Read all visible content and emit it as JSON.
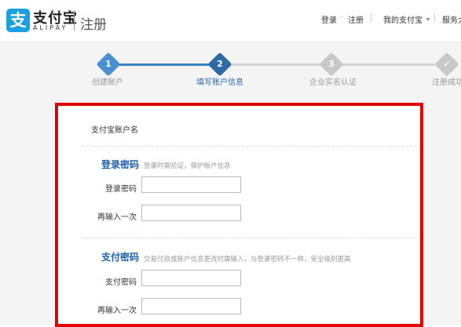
{
  "header": {
    "logo_cn": "支付宝",
    "logo_en": "ALIPAY",
    "page_title": "注册",
    "nav": {
      "login": "登录",
      "dot": "·",
      "register": "注册",
      "my_alipay": "我的支付宝",
      "service": "服务大"
    }
  },
  "steps": [
    {
      "num": "1",
      "label": "创建账户",
      "state": "done"
    },
    {
      "num": "2",
      "label": "填写账户信息",
      "state": "active"
    },
    {
      "num": "3",
      "label": "企业实名认证",
      "state": "pending"
    },
    {
      "num": "✓",
      "label": "注册成功",
      "state": "pending"
    }
  ],
  "form": {
    "account_label": "支付宝账户名",
    "login_section": {
      "title": "登录密码",
      "hint": "登录时需验证，保护账户信息",
      "field1": "登录密码",
      "field2": "再输入一次"
    },
    "pay_section": {
      "title": "支付密码",
      "hint": "交易付款或账户信息更改时需输入，与登录密码不一样，安全级别更高",
      "field1": "支付密码",
      "field2": "再输入一次"
    }
  },
  "colors": {
    "brand": "#1a9fe0",
    "step_done": "#4a90d0",
    "step_active": "#2d6aa6",
    "step_pending": "#c8c8c8",
    "highlight_border": "#e00000"
  }
}
